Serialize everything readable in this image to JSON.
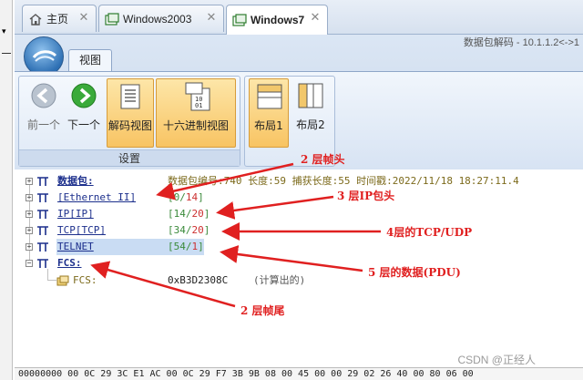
{
  "tabs": [
    {
      "label": "主页",
      "icon": "home-icon"
    },
    {
      "label": "Windows2003",
      "icon": "window-icon"
    },
    {
      "label": "Windows7",
      "icon": "window-icon",
      "active": true
    }
  ],
  "window_title": "数据包解码 - 10.1.1.2<->1",
  "ribbon": {
    "tab_label": "视图",
    "groups": {
      "settings": {
        "label": "设置",
        "buttons": {
          "back": "前一个",
          "next": "下一个",
          "decode_view": "解码视图",
          "hex_view": "十六进制视图"
        }
      },
      "layout": {
        "buttons": {
          "layout1": "布局1",
          "layout2": "布局2"
        }
      }
    }
  },
  "tree": {
    "packet": {
      "name": "数据包:",
      "info": "数据包编号:740 长度:59 捕获长度:55 时间戳:2022/11/18 18:27:11.4"
    },
    "rows": [
      {
        "name": "[Ethernet II]",
        "start": "0",
        "end": "14"
      },
      {
        "name": "IP[IP]",
        "start": "14",
        "end": "20"
      },
      {
        "name": "TCP[TCP]",
        "start": "34",
        "end": "20"
      },
      {
        "name": "TELNET",
        "start": "54",
        "end": "1"
      }
    ],
    "fcs": {
      "name": "FCS:",
      "child_label": "FCS:",
      "value": "0xB3D2308C",
      "note": "(计算出的)"
    }
  },
  "annotations": {
    "frame_head": "2 层帧头",
    "ip_head": "3 层IP包头",
    "tcp_udp": "4层的TCP/UDP",
    "data": "5 层的数据(PDU)",
    "frame_tail": "2 层帧尾"
  },
  "hex_line": "00000000  00 0C 29 3C E1 AC 00 0C 29 F7 3B 9B 08 00 45 00 00 29 02 26 40 00 80 06 00",
  "watermark": "CSDN @正经人",
  "colors": {
    "accent_blue": "#1c2f8c",
    "annotation_red": "#e02020",
    "highlight_orange": "#f8c463",
    "range_green": "#3a8a3a",
    "range_red": "#cc3030"
  }
}
